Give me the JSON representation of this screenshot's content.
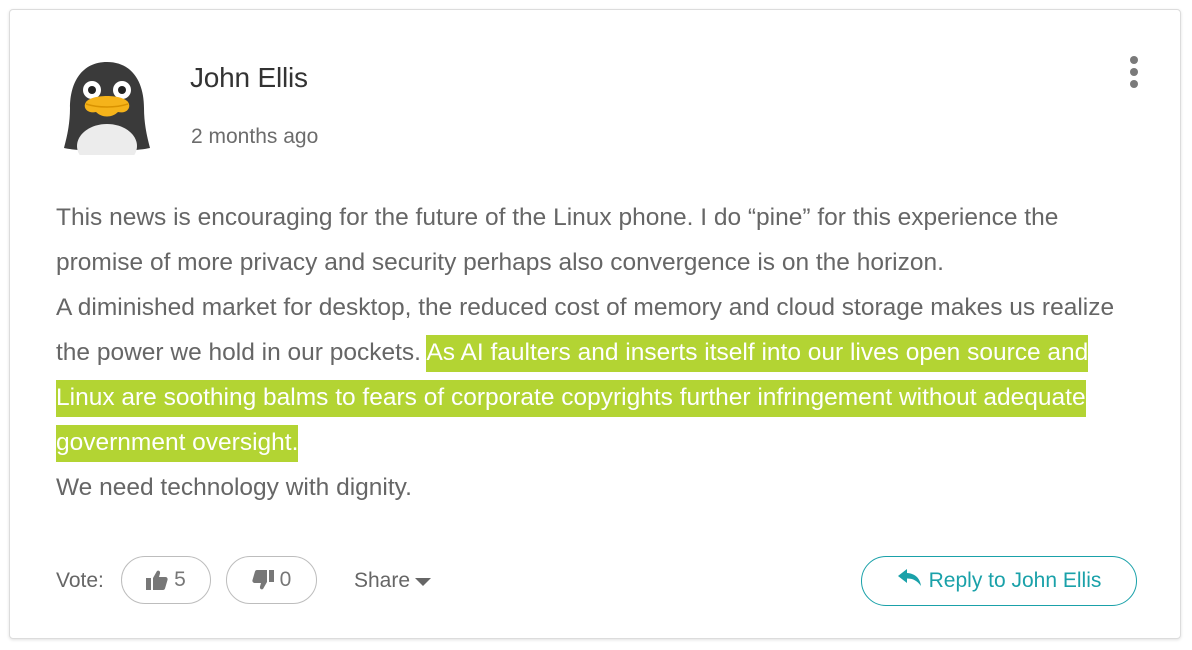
{
  "comment": {
    "author": "John Ellis",
    "timestamp": "2 months ago",
    "avatar_icon": "penguin-avatar",
    "body": {
      "p1": "This news is encouraging for the future of the Linux phone. I do “pine” for this experience the promise of more privacy and security perhaps also convergence is on the horizon.",
      "p2_plain": "A diminished market for desktop, the reduced cost of memory and cloud storage makes us realize the power we hold in our pockets. ",
      "p2_highlight": "As AI faulters and inserts itself into our lives open source and Linux are soothing balms to fears of corporate copyrights further infringement without adequate government oversight.",
      "p3": "We need technology with dignity."
    },
    "highlight_color": "#b3d433"
  },
  "footer": {
    "vote_label": "Vote:",
    "upvote_count": "5",
    "downvote_count": "0",
    "share_label": "Share",
    "reply_label": "Reply to John Ellis",
    "accent_color": "#1aa1a9"
  },
  "icons": {
    "more": "more-vertical-icon",
    "upvote": "thumbs-up-icon",
    "downvote": "thumbs-down-icon",
    "share": "caret-down-icon",
    "reply": "reply-arrow-icon"
  }
}
